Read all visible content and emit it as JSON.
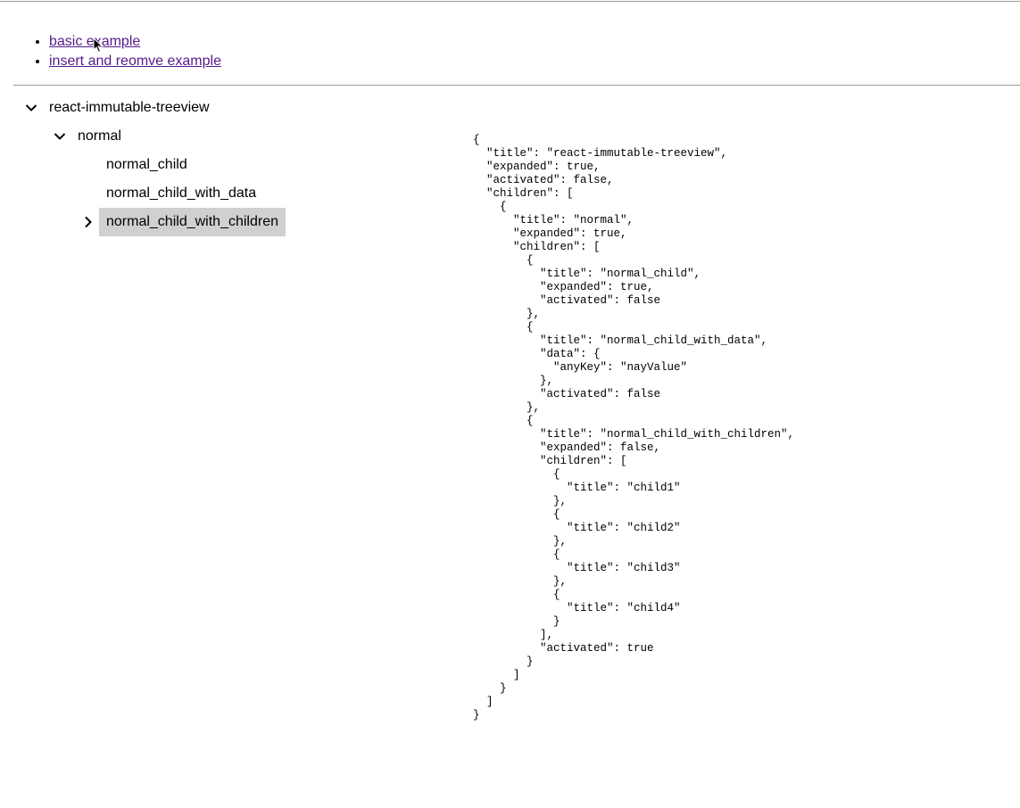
{
  "nav": {
    "links": [
      {
        "label": "basic example"
      },
      {
        "label": "insert and reomve example"
      }
    ]
  },
  "tree": {
    "nodes": [
      {
        "label": "react-immutable-treeview",
        "expanded": true,
        "icon": "chevron-down-icon"
      },
      {
        "label": "normal",
        "expanded": true,
        "icon": "chevron-down-icon"
      },
      {
        "label": "normal_child"
      },
      {
        "label": "normal_child_with_data"
      },
      {
        "label": "normal_child_with_children",
        "expanded": false,
        "activated": true,
        "icon": "chevron-right-icon"
      }
    ]
  },
  "json_output": "{\n  \"title\": \"react-immutable-treeview\",\n  \"expanded\": true,\n  \"activated\": false,\n  \"children\": [\n    {\n      \"title\": \"normal\",\n      \"expanded\": true,\n      \"children\": [\n        {\n          \"title\": \"normal_child\",\n          \"expanded\": true,\n          \"activated\": false\n        },\n        {\n          \"title\": \"normal_child_with_data\",\n          \"data\": {\n            \"anyKey\": \"nayValue\"\n          },\n          \"activated\": false\n        },\n        {\n          \"title\": \"normal_child_with_children\",\n          \"expanded\": false,\n          \"children\": [\n            {\n              \"title\": \"child1\"\n            },\n            {\n              \"title\": \"child2\"\n            },\n            {\n              \"title\": \"child3\"\n            },\n            {\n              \"title\": \"child4\"\n            }\n          ],\n          \"activated\": true\n        }\n      ]\n    }\n  ]\n}",
  "colors": {
    "link_visited": "#551a8b",
    "active_node_bg": "#d0d0d0",
    "divider": "#9a9a9a"
  }
}
